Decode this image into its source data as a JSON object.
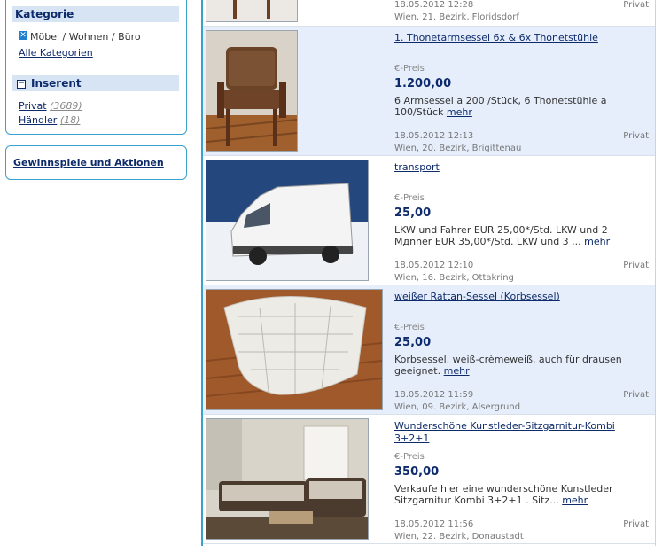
{
  "sidebar": {
    "kategorie_title": "Kategorie",
    "selected_category": "Möbel / Wohnen / Büro",
    "all_categories": "Alle Kategorien",
    "inserent_title": "Inserent",
    "privat_label": "Privat",
    "privat_count": "(3689)",
    "haendler_label": "Händler",
    "haendler_count": "(18)",
    "gewinnspiele": "Gewinnspiele und Aktionen"
  },
  "listings": [
    {
      "title": "",
      "price_label": "",
      "price": "",
      "desc": "",
      "more": "",
      "date": "18.05.2012 12:28",
      "location": "Wien, 21. Bezirk, Floridsdorf",
      "seller": "Privat"
    },
    {
      "title": "1. Thonetarmsessel 6x & 6x Thonetstühle",
      "price_label": "€-Preis",
      "price": "1.200,00",
      "desc": "6 Armsessel a 200 /Stück, 6 Thonetstühle a 100/Stück",
      "more": "mehr",
      "date": "18.05.2012 12:13",
      "location": "Wien, 20. Bezirk, Brigittenau",
      "seller": "Privat"
    },
    {
      "title": "transport",
      "price_label": "€-Preis",
      "price": "25,00",
      "desc": "LKW und Fahrer EUR 25,00*/Std. LKW und 2 Mдnner EUR 35,00*/Std. LKW und 3 ...",
      "more": "mehr",
      "date": "18.05.2012 12:10",
      "location": "Wien, 16. Bezirk, Ottakring",
      "seller": "Privat"
    },
    {
      "title": "weißer Rattan-Sessel (Korbsessel)",
      "price_label": "€-Preis",
      "price": "25,00",
      "desc": "Korbsessel, weiß-crèmeweiß, auch für drausen geeignet.",
      "more": "mehr",
      "date": "18.05.2012 11:59",
      "location": "Wien, 09. Bezirk, Alsergrund",
      "seller": "Privat"
    },
    {
      "title": "Wunderschöne Kunstleder-Sitzgarnitur-Kombi 3+2+1",
      "price_label": "€-Preis",
      "price": "350,00",
      "desc": "Verkaufe hier eine wunderschöne Kunstleder Sitzgarnitur Kombi 3+2+1 . Sitz...",
      "more": "mehr",
      "date": "18.05.2012 11:56",
      "location": "Wien, 22. Bezirk, Donaustadt",
      "seller": "Privat"
    }
  ]
}
